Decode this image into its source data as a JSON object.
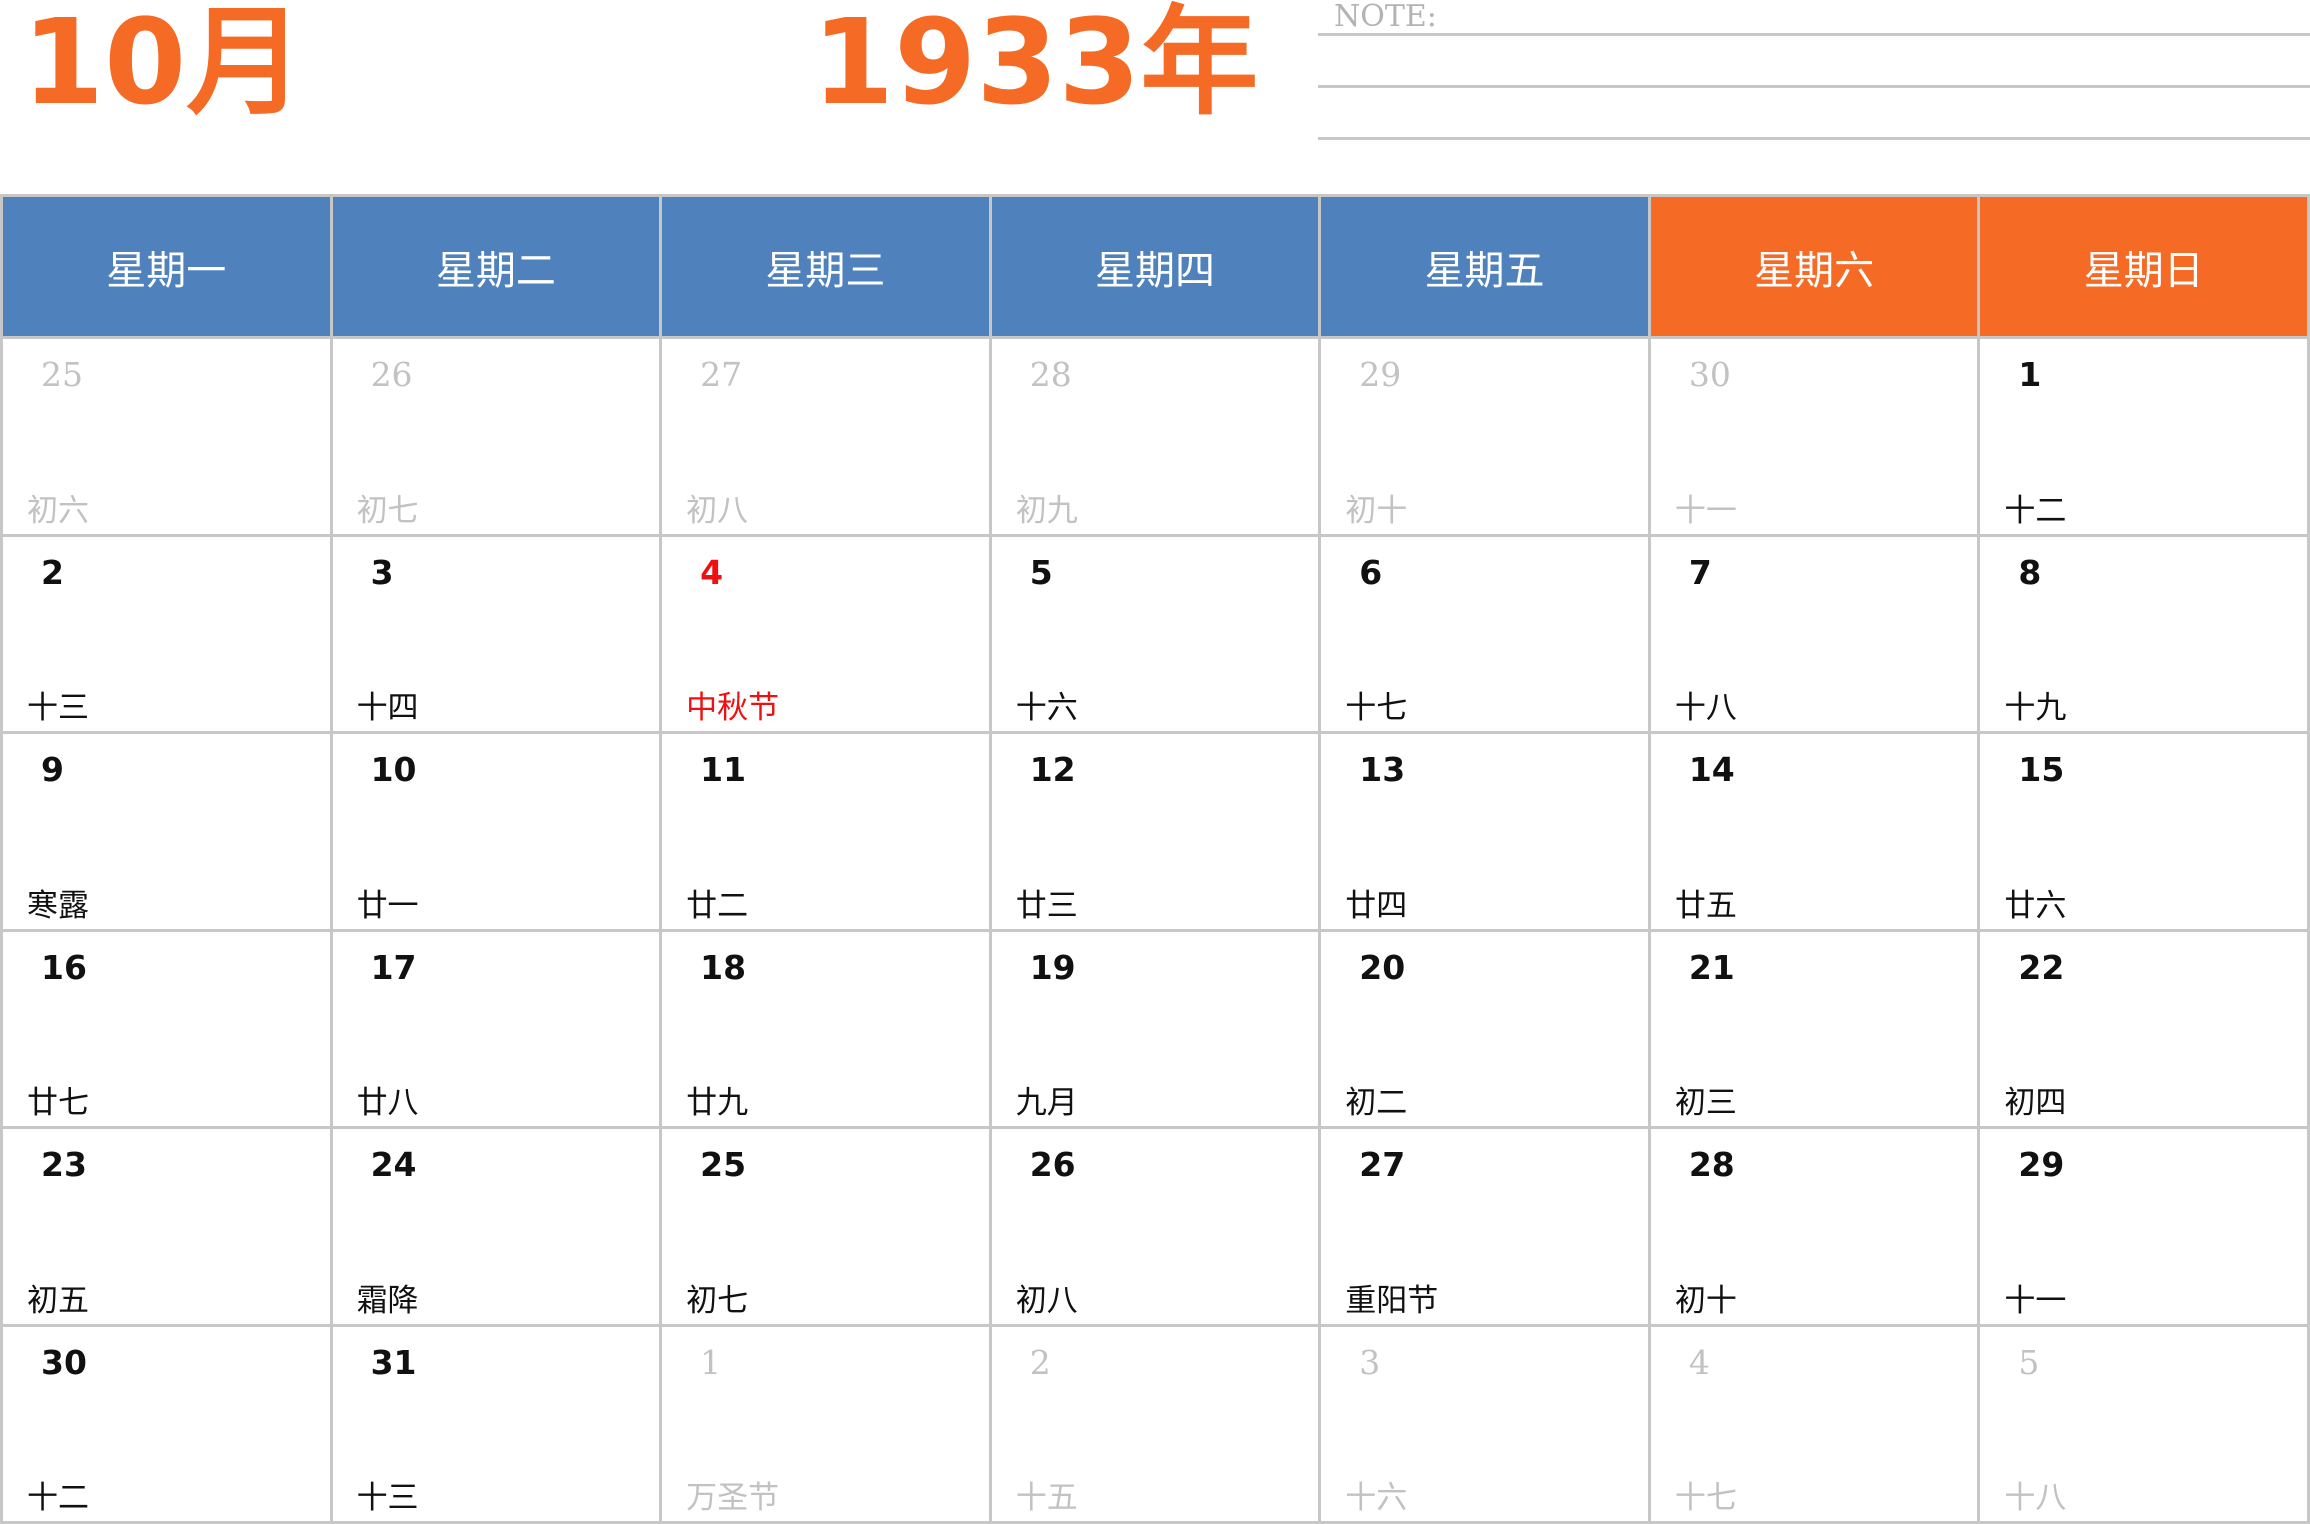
{
  "header": {
    "month": "10月",
    "year": "1933年",
    "note_label": "NOTE:"
  },
  "weekdays": [
    "星期一",
    "星期二",
    "星期三",
    "星期四",
    "星期五",
    "星期六",
    "星期日"
  ],
  "colors": {
    "accent": "#F56A25",
    "weekday_header": "#4F81BD",
    "festival": "#EE1111",
    "muted": "#c2c2c2"
  },
  "weeks": [
    [
      {
        "day": "25",
        "lunar": "初六",
        "type": "outside"
      },
      {
        "day": "26",
        "lunar": "初七",
        "type": "outside"
      },
      {
        "day": "27",
        "lunar": "初八",
        "type": "outside"
      },
      {
        "day": "28",
        "lunar": "初九",
        "type": "outside"
      },
      {
        "day": "29",
        "lunar": "初十",
        "type": "outside"
      },
      {
        "day": "30",
        "lunar": "十一",
        "type": "outside"
      },
      {
        "day": "1",
        "lunar": "十二",
        "type": "normal"
      }
    ],
    [
      {
        "day": "2",
        "lunar": "十三",
        "type": "normal"
      },
      {
        "day": "3",
        "lunar": "十四",
        "type": "normal"
      },
      {
        "day": "4",
        "lunar": "中秋节",
        "type": "festival"
      },
      {
        "day": "5",
        "lunar": "十六",
        "type": "normal"
      },
      {
        "day": "6",
        "lunar": "十七",
        "type": "normal"
      },
      {
        "day": "7",
        "lunar": "十八",
        "type": "normal"
      },
      {
        "day": "8",
        "lunar": "十九",
        "type": "normal"
      }
    ],
    [
      {
        "day": "9",
        "lunar": "寒露",
        "type": "normal"
      },
      {
        "day": "10",
        "lunar": "廿一",
        "type": "normal"
      },
      {
        "day": "11",
        "lunar": "廿二",
        "type": "normal"
      },
      {
        "day": "12",
        "lunar": "廿三",
        "type": "normal"
      },
      {
        "day": "13",
        "lunar": "廿四",
        "type": "normal"
      },
      {
        "day": "14",
        "lunar": "廿五",
        "type": "normal"
      },
      {
        "day": "15",
        "lunar": "廿六",
        "type": "normal"
      }
    ],
    [
      {
        "day": "16",
        "lunar": "廿七",
        "type": "normal"
      },
      {
        "day": "17",
        "lunar": "廿八",
        "type": "normal"
      },
      {
        "day": "18",
        "lunar": "廿九",
        "type": "normal"
      },
      {
        "day": "19",
        "lunar": "九月",
        "type": "normal"
      },
      {
        "day": "20",
        "lunar": "初二",
        "type": "normal"
      },
      {
        "day": "21",
        "lunar": "初三",
        "type": "normal"
      },
      {
        "day": "22",
        "lunar": "初四",
        "type": "normal"
      }
    ],
    [
      {
        "day": "23",
        "lunar": "初五",
        "type": "normal"
      },
      {
        "day": "24",
        "lunar": "霜降",
        "type": "normal"
      },
      {
        "day": "25",
        "lunar": "初七",
        "type": "normal"
      },
      {
        "day": "26",
        "lunar": "初八",
        "type": "normal"
      },
      {
        "day": "27",
        "lunar": "重阳节",
        "type": "normal"
      },
      {
        "day": "28",
        "lunar": "初十",
        "type": "normal"
      },
      {
        "day": "29",
        "lunar": "十一",
        "type": "normal"
      }
    ],
    [
      {
        "day": "30",
        "lunar": "十二",
        "type": "normal"
      },
      {
        "day": "31",
        "lunar": "十三",
        "type": "normal"
      },
      {
        "day": "1",
        "lunar": "万圣节",
        "type": "outside"
      },
      {
        "day": "2",
        "lunar": "十五",
        "type": "outside"
      },
      {
        "day": "3",
        "lunar": "十六",
        "type": "outside"
      },
      {
        "day": "4",
        "lunar": "十七",
        "type": "outside"
      },
      {
        "day": "5",
        "lunar": "十八",
        "type": "outside"
      }
    ]
  ]
}
